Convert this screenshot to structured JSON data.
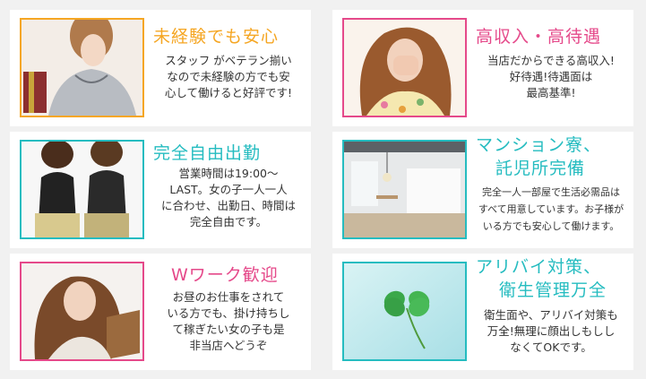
{
  "colors": {
    "orange": "#f5a623",
    "pink": "#e5498a",
    "teal": "#25bcc0"
  },
  "cards": [
    {
      "title": [
        "未経験でも安心"
      ],
      "body": [
        "スタッフ がベテラン揃い",
        "なので未経験の方でも安",
        "心して働けると好評です!"
      ],
      "accent": "orange"
    },
    {
      "title": [
        "高収入・高待遇"
      ],
      "body": [
        "当店だからできる高収入!",
        "好待遇!待遇面は",
        "最高基準!"
      ],
      "accent": "pink"
    },
    {
      "title": [
        "完全自由出勤"
      ],
      "body": [
        "営業時間は19:00～",
        "LAST。女の子一人一人",
        "に合わせ、出勤日、時間は",
        "完全自由です。"
      ],
      "accent": "teal"
    },
    {
      "title": [
        "マンション寮、",
        "託児所完備"
      ],
      "body": [
        "完全一人一部屋で生活必需品は",
        "すべて用意しています。お子様が",
        "いる方でも安心して働けます。"
      ],
      "accent": "teal"
    },
    {
      "title": [
        "Wワーク歓迎"
      ],
      "body": [
        "お昼のお仕事をされて",
        "いる方でも、掛け持ちし",
        "て稼ぎたい女の子も是",
        "非当店へどうぞ"
      ],
      "accent": "pink"
    },
    {
      "title": [
        "アリバイ対策、",
        "衛生管理万全"
      ],
      "body": [
        "衛生面や、アリバイ対策も",
        "万全!無理に顔出しもしし",
        "なくてOKです。"
      ],
      "accent": "teal"
    }
  ]
}
